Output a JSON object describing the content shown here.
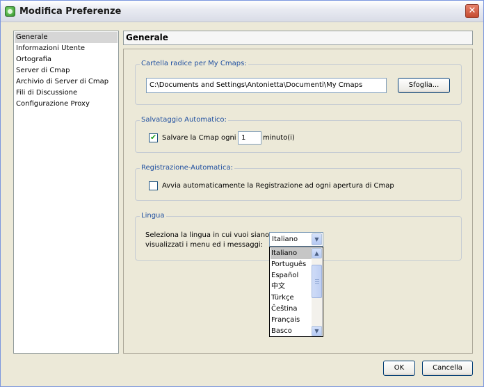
{
  "window": {
    "title": "Modifica Preferenze",
    "close_glyph": "✕"
  },
  "nav": {
    "items": [
      {
        "label": "Generale",
        "selected": true
      },
      {
        "label": "Informazioni Utente"
      },
      {
        "label": "Ortografia"
      },
      {
        "label": "Server di Cmap"
      },
      {
        "label": "Archivio di Server di Cmap"
      },
      {
        "label": "Fili di Discussione"
      },
      {
        "label": "Configurazione Proxy"
      }
    ]
  },
  "header": {
    "title": "Generale"
  },
  "root_folder": {
    "legend": "Cartella radice per My Cmaps:",
    "path": "C:\\Documents and Settings\\Antonietta\\Documenti\\My Cmaps",
    "browse_label": "Sfoglia..."
  },
  "autosave": {
    "legend": "Salvataggio Automatico:",
    "checked": true,
    "checkmark": "✔",
    "label": "Salvare la Cmap ogni",
    "value": "1",
    "unit": "minuto(i)"
  },
  "autoregister": {
    "legend": "Registrazione-Automatica:",
    "checked": false,
    "label": "Avvia automaticamente la Registrazione ad ogni apertura di Cmap"
  },
  "language": {
    "legend": "Lingua",
    "prompt_line1": "Seleziona la lingua in cui vuoi siano",
    "prompt_line2": "visualizzati i menu ed i messaggi:",
    "selected": "Italiano",
    "arrow_glyph": "▼",
    "options": [
      "Italiano",
      "Português",
      "Español",
      "中文",
      "Türkçe",
      "Čeština",
      "Français",
      "Basco"
    ],
    "scroll_up_glyph": "▲",
    "scroll_down_glyph": "▼"
  },
  "footer": {
    "ok_label": "OK",
    "cancel_label": "Cancella"
  },
  "colors": {
    "legend_text": "#1f4fa0",
    "selection": "#d6d6d6",
    "dialog_bg": "#ece9d8"
  }
}
